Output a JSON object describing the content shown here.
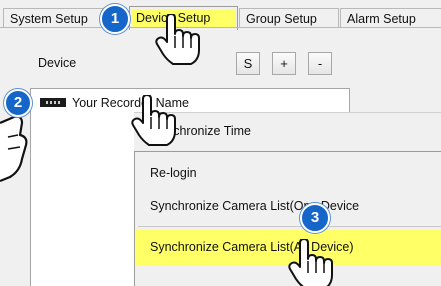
{
  "tabs": {
    "system": "System Setup",
    "device": "Device Setup",
    "group": "Group Setup",
    "alarm": "Alarm Setup"
  },
  "toolbar": {
    "device_label": "Device",
    "s_label": "S",
    "plus_label": "+",
    "minus_label": "-"
  },
  "tree": {
    "recorder_name": "Your Recorder Name"
  },
  "menu": {
    "synchronize_time": "ynchronize Time",
    "relogin": "Re-login",
    "sync_one": "Synchronize Camera List(One Device",
    "sync_all": "Synchronize Camera List(All Device)"
  },
  "steps": {
    "one": "1",
    "two": "2",
    "three": "3"
  },
  "colors": {
    "highlight": "#ffff66",
    "badge": "#1566c8"
  },
  "icons": {
    "cursor": "hand-pointer-icon",
    "recorder": "recorder-icon"
  }
}
